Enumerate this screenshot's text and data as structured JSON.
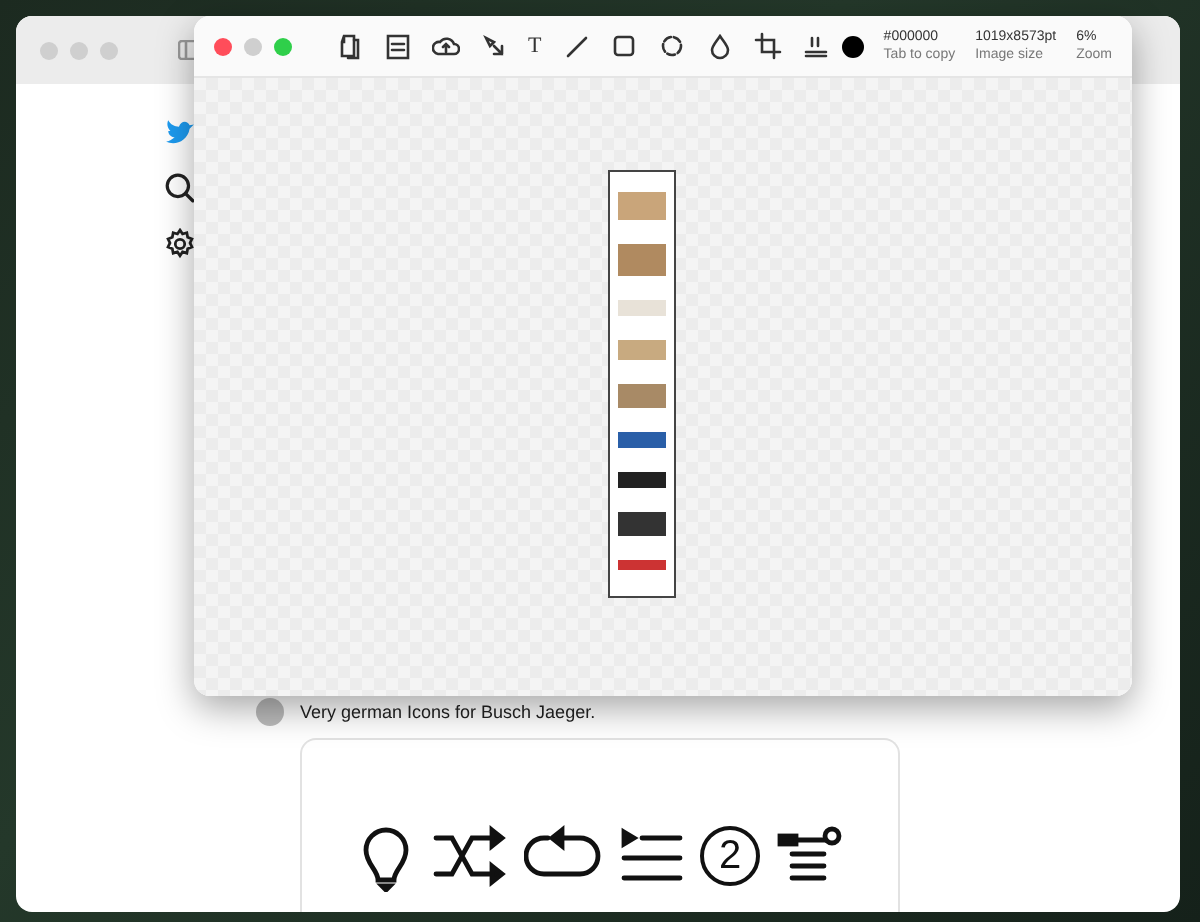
{
  "back_window": {
    "sidebar_icons": [
      {
        "kind": "bird"
      },
      {
        "kind": "search"
      },
      {
        "kind": "settings"
      }
    ],
    "tweet": {
      "text": "Very german Icons for Busch Jaeger.",
      "card_icons": [
        {
          "kind": "bulb"
        },
        {
          "kind": "shuffle"
        },
        {
          "kind": "repeat"
        },
        {
          "kind": "queue"
        },
        {
          "kind": "counter",
          "label": "2"
        },
        {
          "kind": "list-dot"
        }
      ]
    }
  },
  "front_window": {
    "tools": [
      {
        "kind": "copy"
      },
      {
        "kind": "save"
      },
      {
        "kind": "upload"
      },
      {
        "kind": "select"
      },
      {
        "kind": "text",
        "label": "T"
      },
      {
        "kind": "line"
      },
      {
        "kind": "rect"
      },
      {
        "kind": "circle"
      },
      {
        "kind": "drop"
      },
      {
        "kind": "crop"
      },
      {
        "kind": "ruler"
      }
    ],
    "color": {
      "value": "#000000",
      "hint": "Tab to copy"
    },
    "info": [
      {
        "value": "1019x8573pt",
        "label": "Image size"
      },
      {
        "value": "6%",
        "label": "Zoom"
      }
    ]
  }
}
